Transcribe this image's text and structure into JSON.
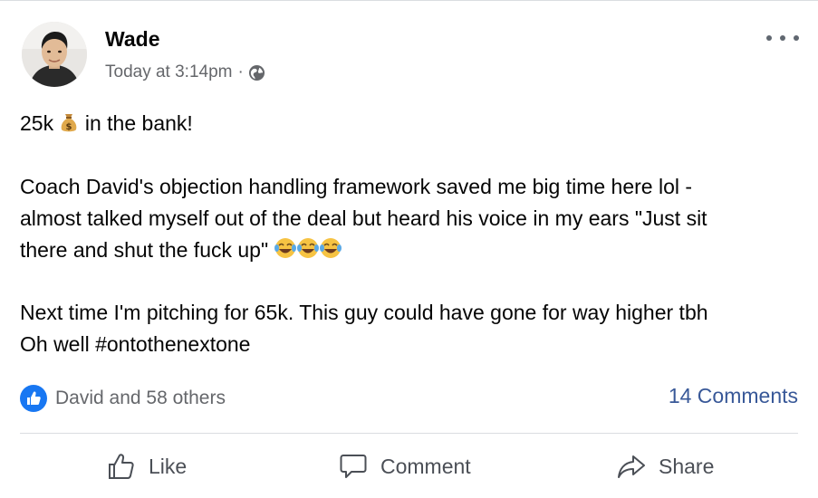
{
  "post": {
    "author": "Wade",
    "timestamp": "Today at 3:14pm",
    "separator": "·",
    "audience_icon": "globe-icon",
    "more_icon": "more-options-icon",
    "lines": [
      {
        "before": "25k ",
        "emoji": "money-bag",
        "after": " in the bank!"
      },
      {
        "text": "Coach David's objection handling framework saved me big time here lol -"
      },
      {
        "text": "almost talked myself out of the deal but heard his voice in my ears \"Just sit"
      },
      {
        "text": "there and shut the fuck up\" ",
        "emoji": "tears-of-joy",
        "emoji_count": 3
      },
      {
        "text": "Next time I'm pitching for 65k. This guy could have gone for way higher tbh"
      },
      {
        "text": "Oh well #ontothenextone"
      }
    ]
  },
  "engagement": {
    "reactions_text": "David and 58 others",
    "reaction_icon": "like-reaction-icon",
    "comments_text": "14 Comments"
  },
  "actions": {
    "like_label": "Like",
    "comment_label": "Comment",
    "share_label": "Share"
  },
  "colors": {
    "like_blue": "#1877f2",
    "link_blue": "#385898",
    "secondary_text": "#65676b",
    "divider": "#dadde1"
  }
}
